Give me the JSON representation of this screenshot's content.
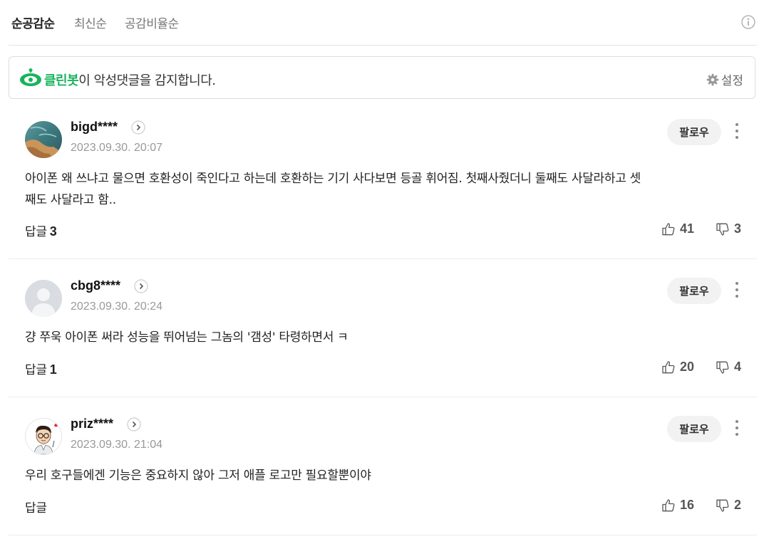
{
  "sort_tabs": [
    "순공감순",
    "최신순",
    "공감비율순"
  ],
  "cleanbot": {
    "brand": "클린봇",
    "message": "이 악성댓글을 감지합니다.",
    "settings_label": "설정",
    "brand_color": "#18b35b"
  },
  "comments": [
    {
      "nickname": "bigd****",
      "date": "2023.09.30. 20:07",
      "follow_label": "팔로우",
      "text_lines": [
        "아이폰 왜 쓰냐고 물으면 호환성이 죽인다고 하는데 호환하는 기기 사다보면 등골 휘어짐. 첫째사줬더니 둘째도 사달라하고 셋",
        "째도 사달라고 함.."
      ],
      "reply_label": "답글",
      "reply_count": "3",
      "likes": "41",
      "dislikes": "3",
      "avatar": "landscape-photo"
    },
    {
      "nickname": "cbg8****",
      "date": "2023.09.30. 20:24",
      "follow_label": "팔로우",
      "text_lines": [
        "걍 쭈욱 아이폰 써라 성능을 뛰어넘는 그놈의 '갬성' 타령하면서 ㅋ"
      ],
      "reply_label": "답글",
      "reply_count": "1",
      "likes": "20",
      "dislikes": "4",
      "avatar": "default-person"
    },
    {
      "nickname": "priz****",
      "date": "2023.09.30. 21:04",
      "follow_label": "팔로우",
      "text_lines": [
        "우리 호구들에겐 기능은 중요하지 않아 그저 애플 로고만 필요할뿐이야"
      ],
      "reply_label": "답글",
      "reply_count": "",
      "likes": "16",
      "dislikes": "2",
      "avatar": "cartoon-character"
    }
  ]
}
